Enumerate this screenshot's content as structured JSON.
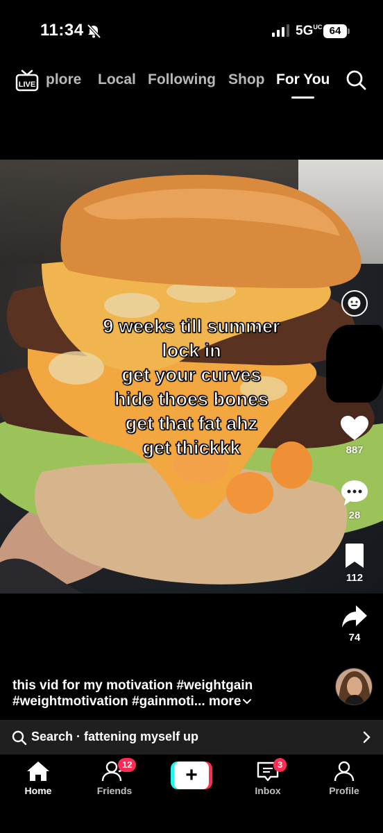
{
  "status": {
    "time": "11:34",
    "network": "5G",
    "network_suffix": "UC",
    "battery": "64"
  },
  "top_nav": {
    "live_label": "LIVE",
    "tabs": [
      {
        "label": "plore"
      },
      {
        "label": "Local"
      },
      {
        "label": "Following"
      },
      {
        "label": "Shop"
      },
      {
        "label": "For You"
      }
    ]
  },
  "video": {
    "caption_lines": [
      "9 weeks till summer",
      "lock in",
      "get your curves",
      "hide thoes bones",
      "get that fat ahz",
      "get thickkk"
    ]
  },
  "actions": {
    "likes": "887",
    "comments": "28",
    "saves": "112",
    "shares": "74"
  },
  "description": {
    "line1": "this vid for my motivation #weightgain",
    "line2": "#weightmotivation #gainmoti...",
    "more": "more"
  },
  "search_bar": {
    "text": "Search · fattening myself up"
  },
  "bottom_nav": {
    "home": "Home",
    "friends": "Friends",
    "friends_badge": "12",
    "create": "+",
    "inbox": "Inbox",
    "inbox_badge": "3",
    "profile": "Profile"
  },
  "colors": {
    "brand_red": "#fe2c55",
    "brand_cyan": "#25f4ee",
    "background": "#000000"
  }
}
